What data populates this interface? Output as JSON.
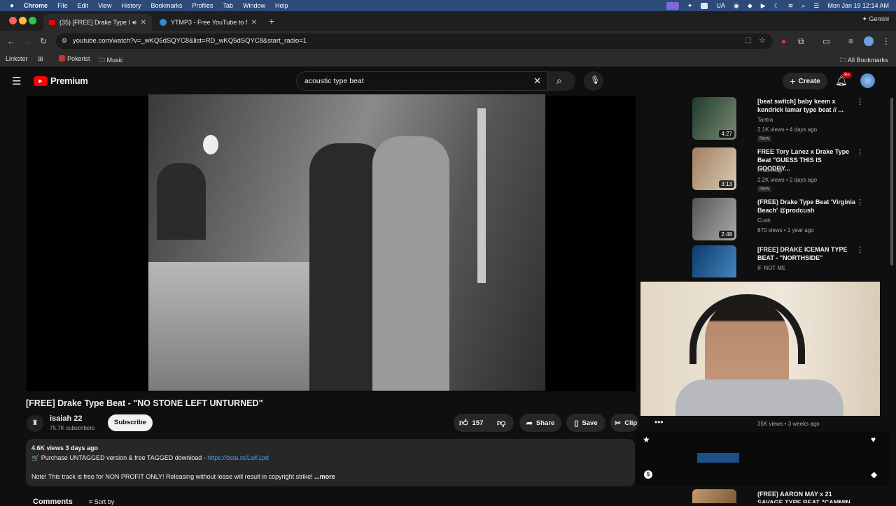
{
  "menubar": {
    "items": [
      "Chrome",
      "File",
      "Edit",
      "View",
      "History",
      "Bookmarks",
      "Profiles",
      "Tab",
      "Window",
      "Help"
    ],
    "input_source": "UA",
    "datetime": "Mon Jan 19  12:14 AM",
    "gemini": "Gemini"
  },
  "tabs": [
    {
      "title": "(35) [FREE] Drake Type B"
    },
    {
      "title": "YTMP3 - Free YouTube to MP"
    }
  ],
  "address": {
    "url": "youtube.com/watch?v=_wKQ5dSQYC8&list=RD_wKQ5dSQYC8&start_radio=1"
  },
  "bookmarks": {
    "items": [
      "Linkster",
      "Pokerist",
      "Music"
    ],
    "all": "All Bookmarks"
  },
  "youtube": {
    "logo": "Premium",
    "search_value": "acoustic type beat",
    "create_label": "Create",
    "notif_count": "9+"
  },
  "video": {
    "title": "[FREE] Drake Type Beat - \"NO STONE LEFT UNTURNED\"",
    "channel": "isaiah 22",
    "subscribers": "75.7K subscribers",
    "subscribe_label": "Subscribe",
    "likes": "157",
    "share_label": "Share",
    "save_label": "Save",
    "clip_label": "Clip",
    "views_date": "4.6K views  3 days ago",
    "desc_line1": "🛒 Purchase UNTAGGED version & free TAGGED download - ",
    "desc_link": "https://bsta.rs/LaK1pd",
    "desc_line2": "Note! This track is free for NON PROFIT ONLY! Releasing without lease will result in copyright strike!",
    "more_label": "...more",
    "comments_partial": "Comments",
    "sort_partial": "Sort by"
  },
  "recommended": [
    {
      "title": "[beat switch] baby keem x kendrick lamar type beat // ...",
      "channel": "Tantra",
      "meta": "2.1K views • 4 days ago",
      "badge": "New",
      "duration": "4:27"
    },
    {
      "title": "FREE Tory Lanez x Drake Type Beat \"GUESS THIS IS GOODBY...",
      "channel": "Prod Regi",
      "meta": "2.2K views • 2 days ago",
      "badge": "New",
      "duration": "3:13"
    },
    {
      "title": "(FREE) Drake Type Beat 'Virginia Beach' @prodcush",
      "channel": "Cush",
      "meta": "870 views • 1 year ago",
      "badge": "",
      "duration": "2:49"
    },
    {
      "title": "[FREE] DRAKE ICEMAN TYPE BEAT - \"NORTHSIDE\"",
      "channel": "IF NOT ME",
      "meta": "",
      "badge": "",
      "duration": ""
    }
  ],
  "rec_partial": {
    "meta": "35K views • 3 weeks ago",
    "title_bottom": "(FREE) AARON MAY x 21 SAVAGE TYPE BEAT \"CAMMIN"
  }
}
